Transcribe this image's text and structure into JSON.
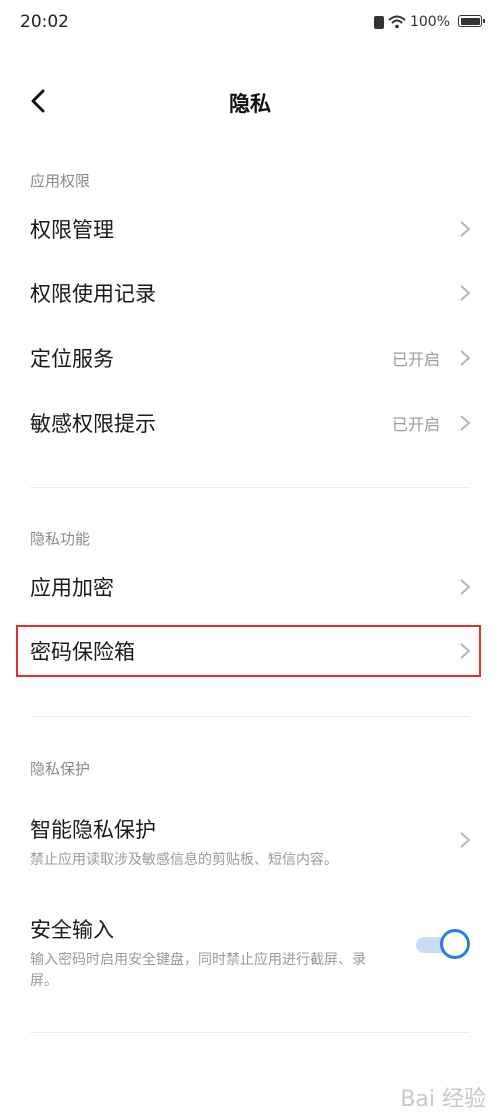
{
  "status_bar": {
    "time": "20:02",
    "battery": "100%"
  },
  "header": {
    "title": "隐私"
  },
  "sections": {
    "permissions": {
      "label": "应用权限",
      "items": [
        {
          "label": "权限管理",
          "value": ""
        },
        {
          "label": "权限使用记录",
          "value": ""
        },
        {
          "label": "定位服务",
          "value": "已开启"
        },
        {
          "label": "敏感权限提示",
          "value": "已开启"
        }
      ]
    },
    "features": {
      "label": "隐私功能",
      "items": [
        {
          "label": "应用加密"
        },
        {
          "label": "密码保险箱"
        }
      ]
    },
    "protection": {
      "label": "隐私保护",
      "items": [
        {
          "label": "智能隐私保护",
          "description": "禁止应用读取涉及敏感信息的剪贴板、短信内容。"
        },
        {
          "label": "安全输入",
          "description": "输入密码时启用安全键盘，同时禁止应用进行截屏、录屏。",
          "toggle_on": true
        }
      ]
    }
  },
  "colors": {
    "accent": "#2a7de1",
    "highlight": "#e03030"
  },
  "watermark": "Bai 经验"
}
